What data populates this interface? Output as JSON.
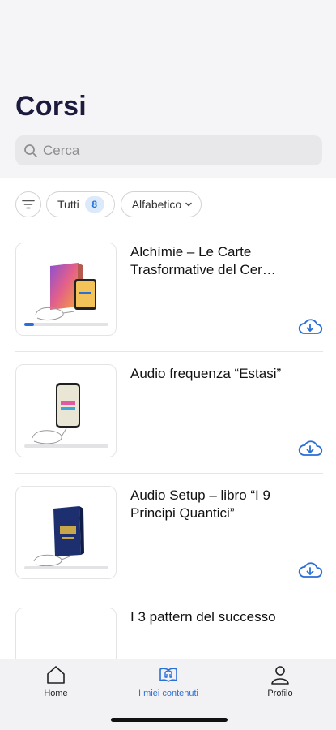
{
  "header": {
    "title": "Corsi"
  },
  "search": {
    "placeholder": "Cerca"
  },
  "filters": {
    "all_label": "Tutti",
    "all_count": "8",
    "sort_label": "Alfabetico"
  },
  "courses": [
    {
      "title": "Alchìmie – Le Carte Trasformative del Cer…",
      "progress": 0.12
    },
    {
      "title": "Audio frequenza “Estasi”",
      "progress": 0
    },
    {
      "title": "Audio Setup – libro “I 9 Principi Quantici”",
      "progress": 0
    },
    {
      "title": "I 3 pattern del successo",
      "progress": 0
    }
  ],
  "tabs": {
    "home": "Home",
    "content": "I miei contenuti",
    "profile": "Profilo"
  },
  "colors": {
    "accent": "#2a6fd6",
    "title": "#1c1a3d",
    "badge_bg": "#dbe9fb"
  }
}
